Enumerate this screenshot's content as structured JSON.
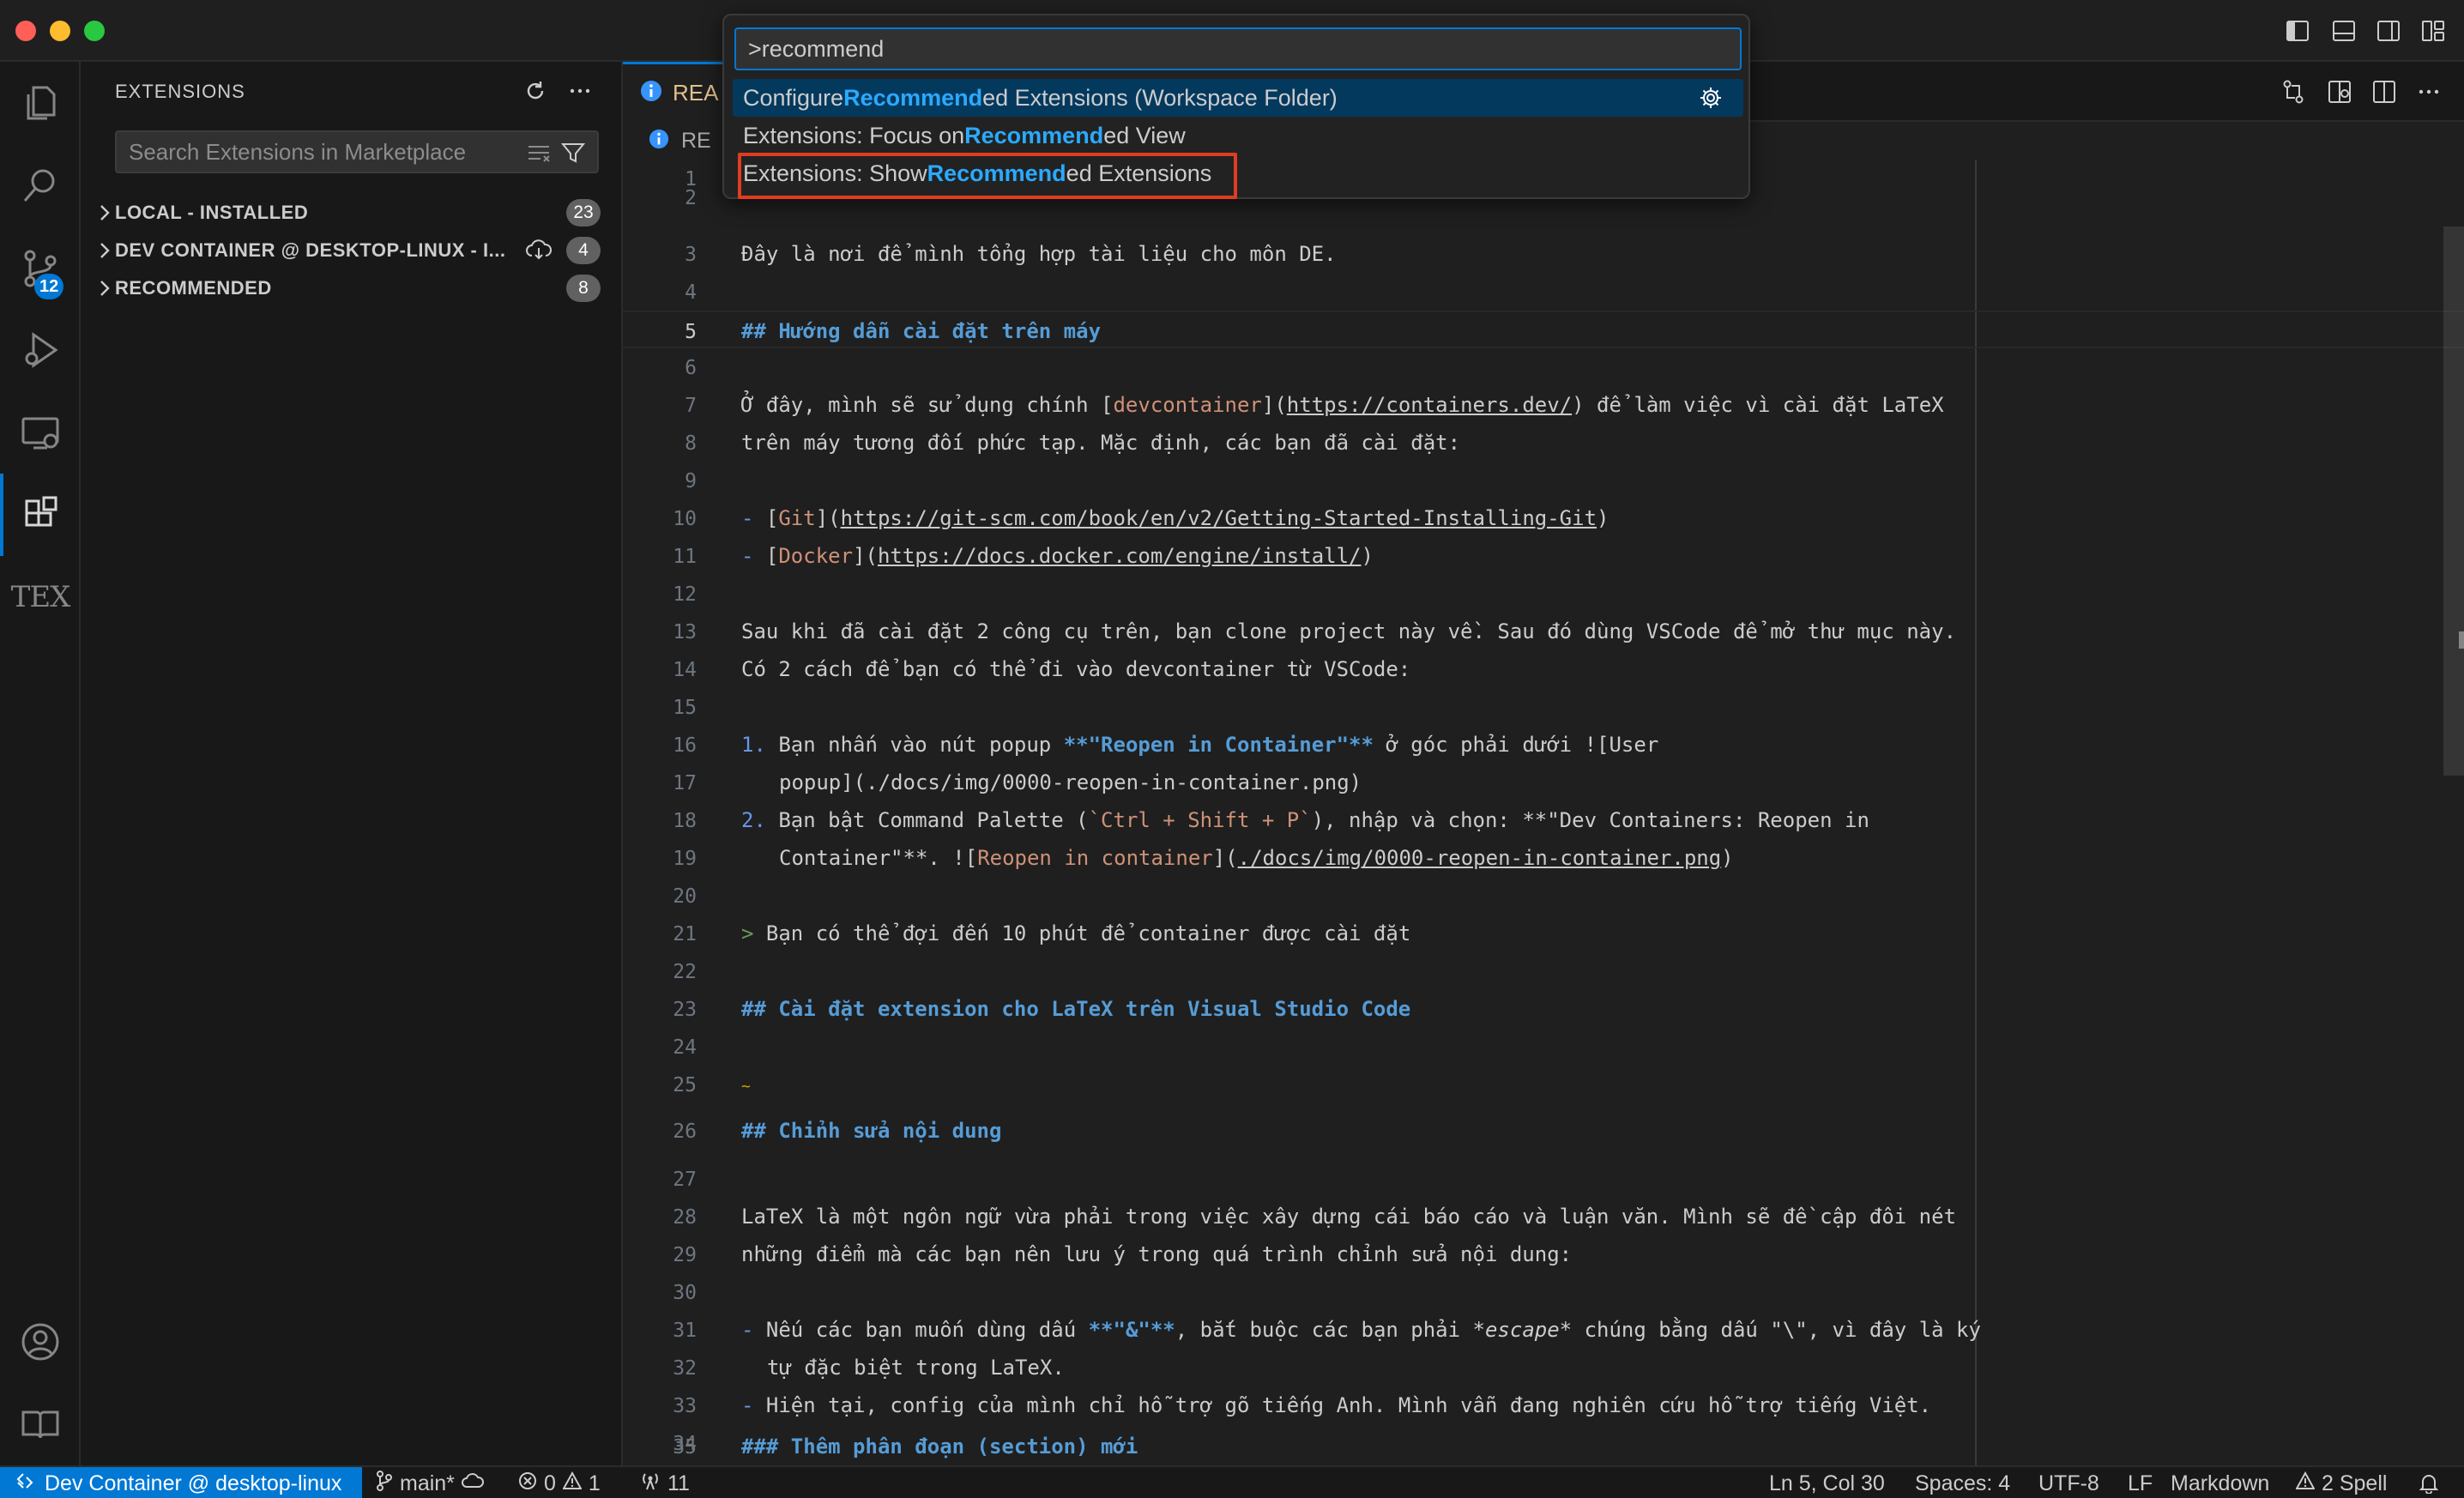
{
  "sidebar": {
    "title": "EXTENSIONS",
    "search_placeholder": "Search Extensions in Marketplace",
    "sections": [
      {
        "label": "LOCAL - INSTALLED",
        "count": "23"
      },
      {
        "label": "DEV CONTAINER @ DESKTOP-LINUX - I...",
        "count": "4"
      },
      {
        "label": "RECOMMENDED",
        "count": "8"
      }
    ]
  },
  "activity": {
    "source_control_badge": "12",
    "tex_label": "TEX"
  },
  "editor": {
    "tab_label": "REA",
    "breadcrumb_label": "RE",
    "line_numbers": [
      "1",
      "2",
      "3",
      "4",
      "5",
      "6",
      "7",
      "8",
      "9",
      "10",
      "11",
      "12",
      "13",
      "14",
      "15",
      "16",
      "17",
      "18",
      "19",
      "20",
      "21",
      "22",
      "23",
      "24",
      "25",
      "26",
      "27",
      "28",
      "29",
      "30",
      "31",
      "32",
      "33",
      "34",
      "35"
    ],
    "lines": {
      "l3": "Đây là nơi để mình tổng hợp tài liệu cho môn DE.",
      "l5": "## Hướng dẫn cài đặt trên máy",
      "l7a": "Ở đây, mình sẽ sử dụng chính [",
      "l7b": "devcontainer",
      "l7c": "](",
      "l7d": "https://containers.dev/",
      "l7e": ") để làm việc vì cài đặt LaTeX",
      "l8": "trên máy tương đối phức tạp. Mặc định, các bạn đã cài đặt:",
      "l10a": "- ",
      "l10b": "[",
      "l10c": "Git",
      "l10d": "](",
      "l10e": "https://git-scm.com/book/en/v2/Getting-Started-Installing-Git",
      "l10f": ")",
      "l11a": "- ",
      "l11b": "[",
      "l11c": "Docker",
      "l11d": "](",
      "l11e": "https://docs.docker.com/engine/install/",
      "l11f": ")",
      "l13": "Sau khi đã cài đặt 2 công cụ trên, bạn clone project này về. Sau đó dùng VSCode để mở thư mục này.",
      "l14": "Có 2 cách để bạn có thể đi vào devcontainer từ VSCode:",
      "l16a": "1. ",
      "l16b": "Bạn nhấn vào nút popup ",
      "l16c": "**\"Reopen in Container\"**",
      "l16d": " ở góc phải dưới ![User",
      "l17": "popup](./docs/img/0000-reopen-in-container.png)",
      "l18a": "2. ",
      "l18b": "Bạn bật Command Palette (",
      "l18c": "`Ctrl + Shift + P`",
      "l18d": "), nhập và chọn: **\"Dev Containers: Reopen in",
      "l19a": "Container\"**. ![",
      "l19b": "Reopen in container",
      "l19c": "](",
      "l19d": "./docs/img/0000-reopen-in-container.png",
      "l19e": ")",
      "l21a": "> ",
      "l21b": "Bạn có thể đợi đến 10 phút để container được cài đặt",
      "l23": "## Cài đặt extension cho LaTeX trên Visual Studio Code",
      "l25": "~",
      "l26": "## Chỉnh sửa nội dung",
      "l28": "LaTeX là một ngôn ngữ vừa phải trong việc xây dựng cái báo cáo và luận văn. Mình sẽ đề cập đôi nét",
      "l29": "những điểm mà các bạn nên lưu ý trong quá trình chỉnh sửa nội dung:",
      "l31a": "- ",
      "l31b": "Nếu các bạn muốn dùng dấu ",
      "l31c": "**\"&\"**",
      "l31d": ", bắt buộc các bạn phải ",
      "l31e": "*escape*",
      "l31f": " chúng bằng dấu \"\\\", vì đây là ký",
      "l32": "tự đặc biệt trong LaTeX.",
      "l33a": "- ",
      "l33b": "Hiện tại, config của mình chỉ hỗ trợ gõ tiếng Anh. Mình vẫn đang nghiên cứu hỗ trợ tiếng Việt.",
      "l35": "### Thêm phân đoạn (section) mới"
    }
  },
  "palette": {
    "query": ">recommend",
    "items": [
      {
        "pre": "Configure ",
        "hl": "Recommend",
        "post": "ed Extensions (Workspace Folder)"
      },
      {
        "pre": "Extensions: Focus on ",
        "hl": "Recommend",
        "post": "ed View"
      },
      {
        "pre": "Extensions: Show ",
        "hl": "Recommend",
        "post": "ed Extensions"
      }
    ]
  },
  "statusbar": {
    "remote": "Dev Container @ desktop-linux",
    "branch": "main*",
    "errors": "0",
    "warnings": "1",
    "ports": "11",
    "position": "Ln 5, Col 30",
    "spaces": "Spaces: 4",
    "encoding": "UTF-8",
    "eol": "LF",
    "language": "Markdown",
    "spell": "2 Spell"
  },
  "colors": {
    "accent": "#0078d4",
    "highlight_outline": "#e03c21",
    "palette_match": "#2aaaff",
    "tab_modified": "#e2c08d"
  }
}
